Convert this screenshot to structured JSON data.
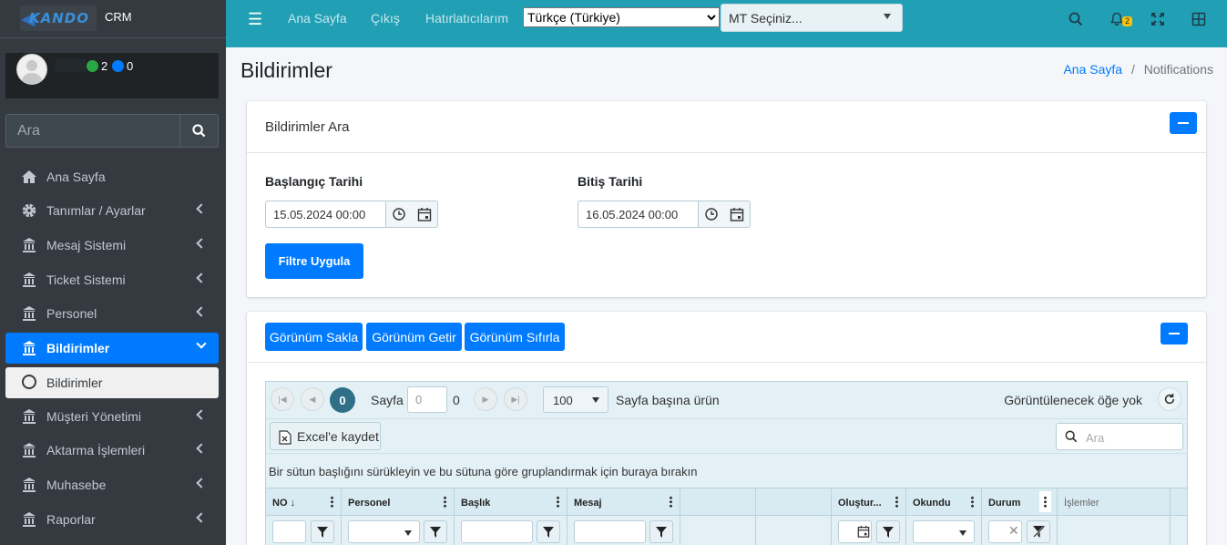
{
  "brand": {
    "logo_text": "KANDO",
    "app_name": "CRM"
  },
  "user": {
    "online_count": "2",
    "other_count": "0",
    "status_colors": {
      "online": "#28a745",
      "other": "#007bff"
    }
  },
  "sidebar": {
    "search_placeholder": "Ara",
    "items": [
      {
        "label": "Ana Sayfa",
        "icon": "home-icon"
      },
      {
        "label": "Tanımlar / Ayarlar",
        "icon": "gear-icon"
      },
      {
        "label": "Mesaj Sistemi",
        "icon": "building-icon"
      },
      {
        "label": "Ticket Sistemi",
        "icon": "building-icon"
      },
      {
        "label": "Personel",
        "icon": "building-icon"
      },
      {
        "label": "Bildirimler",
        "icon": "building-icon",
        "active": true
      },
      {
        "label": "Bildirimler",
        "icon": "circle-icon",
        "sub": true
      },
      {
        "label": "Müşteri Yönetimi",
        "icon": "building-icon"
      },
      {
        "label": "Aktarma İşlemleri",
        "icon": "building-icon"
      },
      {
        "label": "Muhasebe",
        "icon": "building-icon"
      },
      {
        "label": "Raporlar",
        "icon": "building-icon"
      }
    ]
  },
  "topbar": {
    "links": [
      "Ana Sayfa",
      "Çıkış",
      "Hatırlatıcılarım"
    ],
    "language": "Türkçe (Türkiye)",
    "mt_select": "MT Seçiniz...",
    "notification_count": "2",
    "accent": "#21a0b5"
  },
  "page": {
    "title": "Bildirimler",
    "breadcrumb_home": "Ana Sayfa",
    "breadcrumb_sep": "/",
    "breadcrumb_current": "Notifications"
  },
  "filter_card": {
    "title": "Bildirimler Ara",
    "start_label": "Başlangıç Tarihi",
    "start_value": "15.05.2024 00:00",
    "end_label": "Bitiş Tarihi",
    "end_value": "16.05.2024 00:00",
    "apply_label": "Filtre Uygula"
  },
  "view_buttons": {
    "save": "Görünüm Sakla",
    "load": "Görünüm Getir",
    "reset": "Görünüm Sıfırla"
  },
  "grid": {
    "page_number": "0",
    "page_label": "Sayfa",
    "page_input": "0",
    "page_total": "0",
    "page_size": "100",
    "page_size_label": "Sayfa başına ürün",
    "no_items": "Görüntülenecek öğe yok",
    "excel_label": "Excel'e kaydet",
    "search_placeholder": "Ara",
    "grouping_hint": "Bir sütun başlığını sürükleyin ve bu sütuna göre gruplandırmak için buraya bırakın",
    "columns": [
      "NO",
      "Personel",
      "Başlık",
      "Mesaj",
      "",
      "",
      "Oluştur...",
      "Okundu",
      "Durum",
      "İşlemler"
    ]
  },
  "colors": {
    "primary": "#007bff",
    "sidebar": "#343a40"
  }
}
